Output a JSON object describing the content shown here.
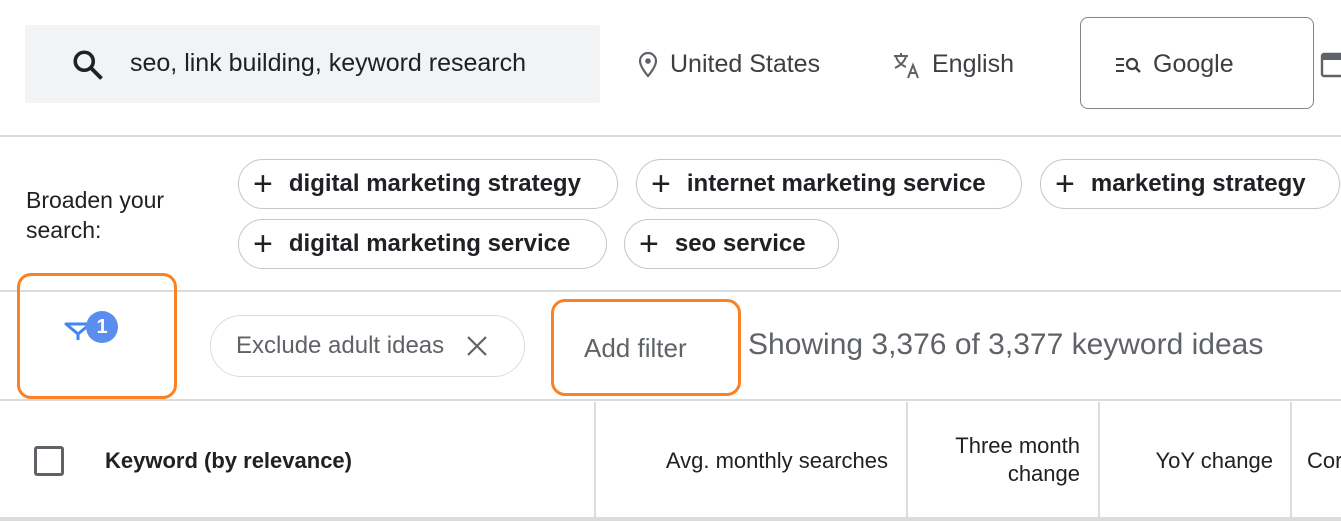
{
  "search": {
    "value": "seo, link building, keyword research",
    "icon": "search-icon"
  },
  "location": {
    "label": "United States",
    "icon": "location-pin-icon"
  },
  "language": {
    "label": "English",
    "icon": "translate-icon"
  },
  "network": {
    "label": "Google",
    "icon": "search-list-icon"
  },
  "broaden": {
    "label": "Broaden your search:",
    "chips": [
      "digital marketing strategy",
      "internet marketing service",
      "marketing strategy",
      "digital marketing service",
      "seo service"
    ]
  },
  "filters": {
    "badge_count": "1",
    "active_filter": "Exclude adult ideas",
    "add_filter_label": "Add filter",
    "showing_text": "Showing 3,376 of 3,377 keyword ideas",
    "highlight_color": "#fb8122",
    "accent_color": "#4285f4"
  },
  "table": {
    "columns": [
      "Keyword (by relevance)",
      "Avg. monthly searches",
      "Three month change",
      "YoY change",
      "Cor"
    ]
  }
}
